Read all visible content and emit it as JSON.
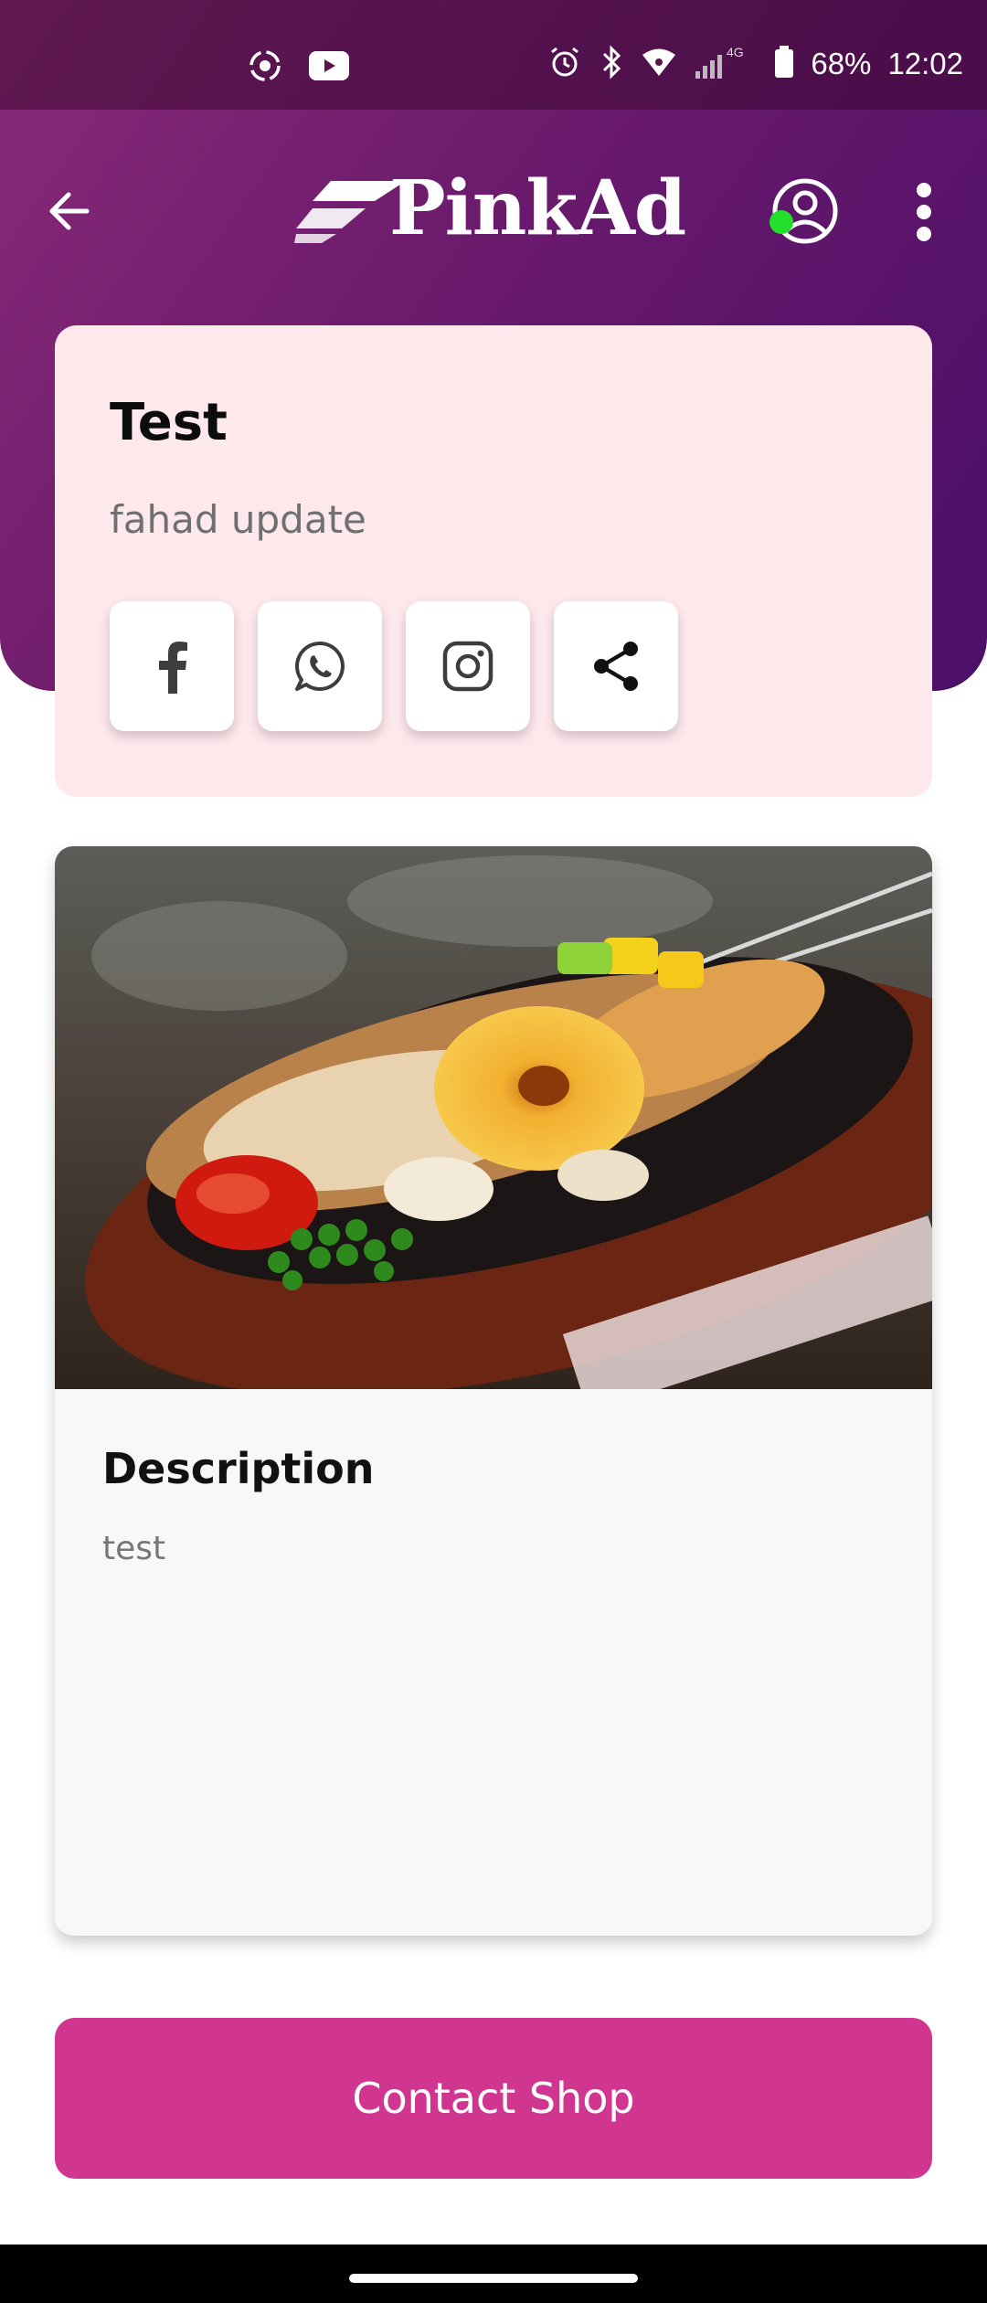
{
  "status_bar": {
    "battery": "68%",
    "time": "12:02",
    "network": "4G"
  },
  "app_bar": {
    "logo_text": "PinkAd",
    "back_icon": "arrow-left-icon",
    "profile_icon": "user-circle-icon",
    "menu_icon": "more-vertical-icon",
    "online": true
  },
  "shop": {
    "title": "Test",
    "subtitle": "fahad update"
  },
  "social": [
    {
      "name": "facebook-icon"
    },
    {
      "name": "whatsapp-icon"
    },
    {
      "name": "instagram-icon"
    },
    {
      "name": "share-icon"
    }
  ],
  "listing": {
    "description_heading": "Description",
    "description_text": "test"
  },
  "contact_button": "Contact Shop",
  "colors": {
    "header_start": "#8a2a78",
    "header_end": "#4a0f68",
    "card_pink": "#fde8ec",
    "accent": "#d0368f",
    "online": "#22e02a"
  }
}
